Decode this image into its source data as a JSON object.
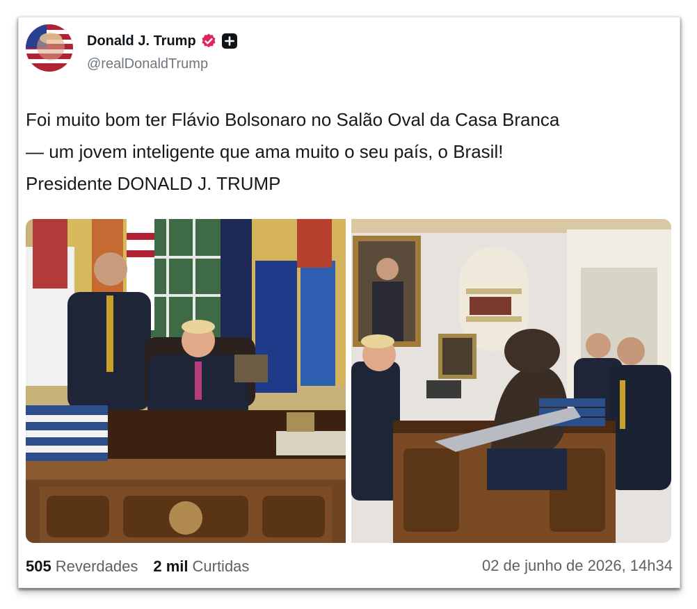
{
  "post": {
    "author_name": "Donald J. Trump",
    "handle": "@realDonaldTrump",
    "verified_icon": "verified-badge-icon",
    "plus_icon": "follow-plus-icon",
    "text": "Foi muito bom ter Flávio Bolsonaro no Salão Oval da Casa Branca\n— um jovem inteligente que ama muito o seu país, o Brasil!\nPresidente DONALD J. TRUMP",
    "accent_color": "#e0245e"
  },
  "stats": {
    "reposts_count": "505",
    "reposts_label": "Reverdades",
    "likes_count": "2 mil",
    "likes_label": "Curtidas"
  },
  "timestamp": "02 de junho de 2026, 14h34"
}
